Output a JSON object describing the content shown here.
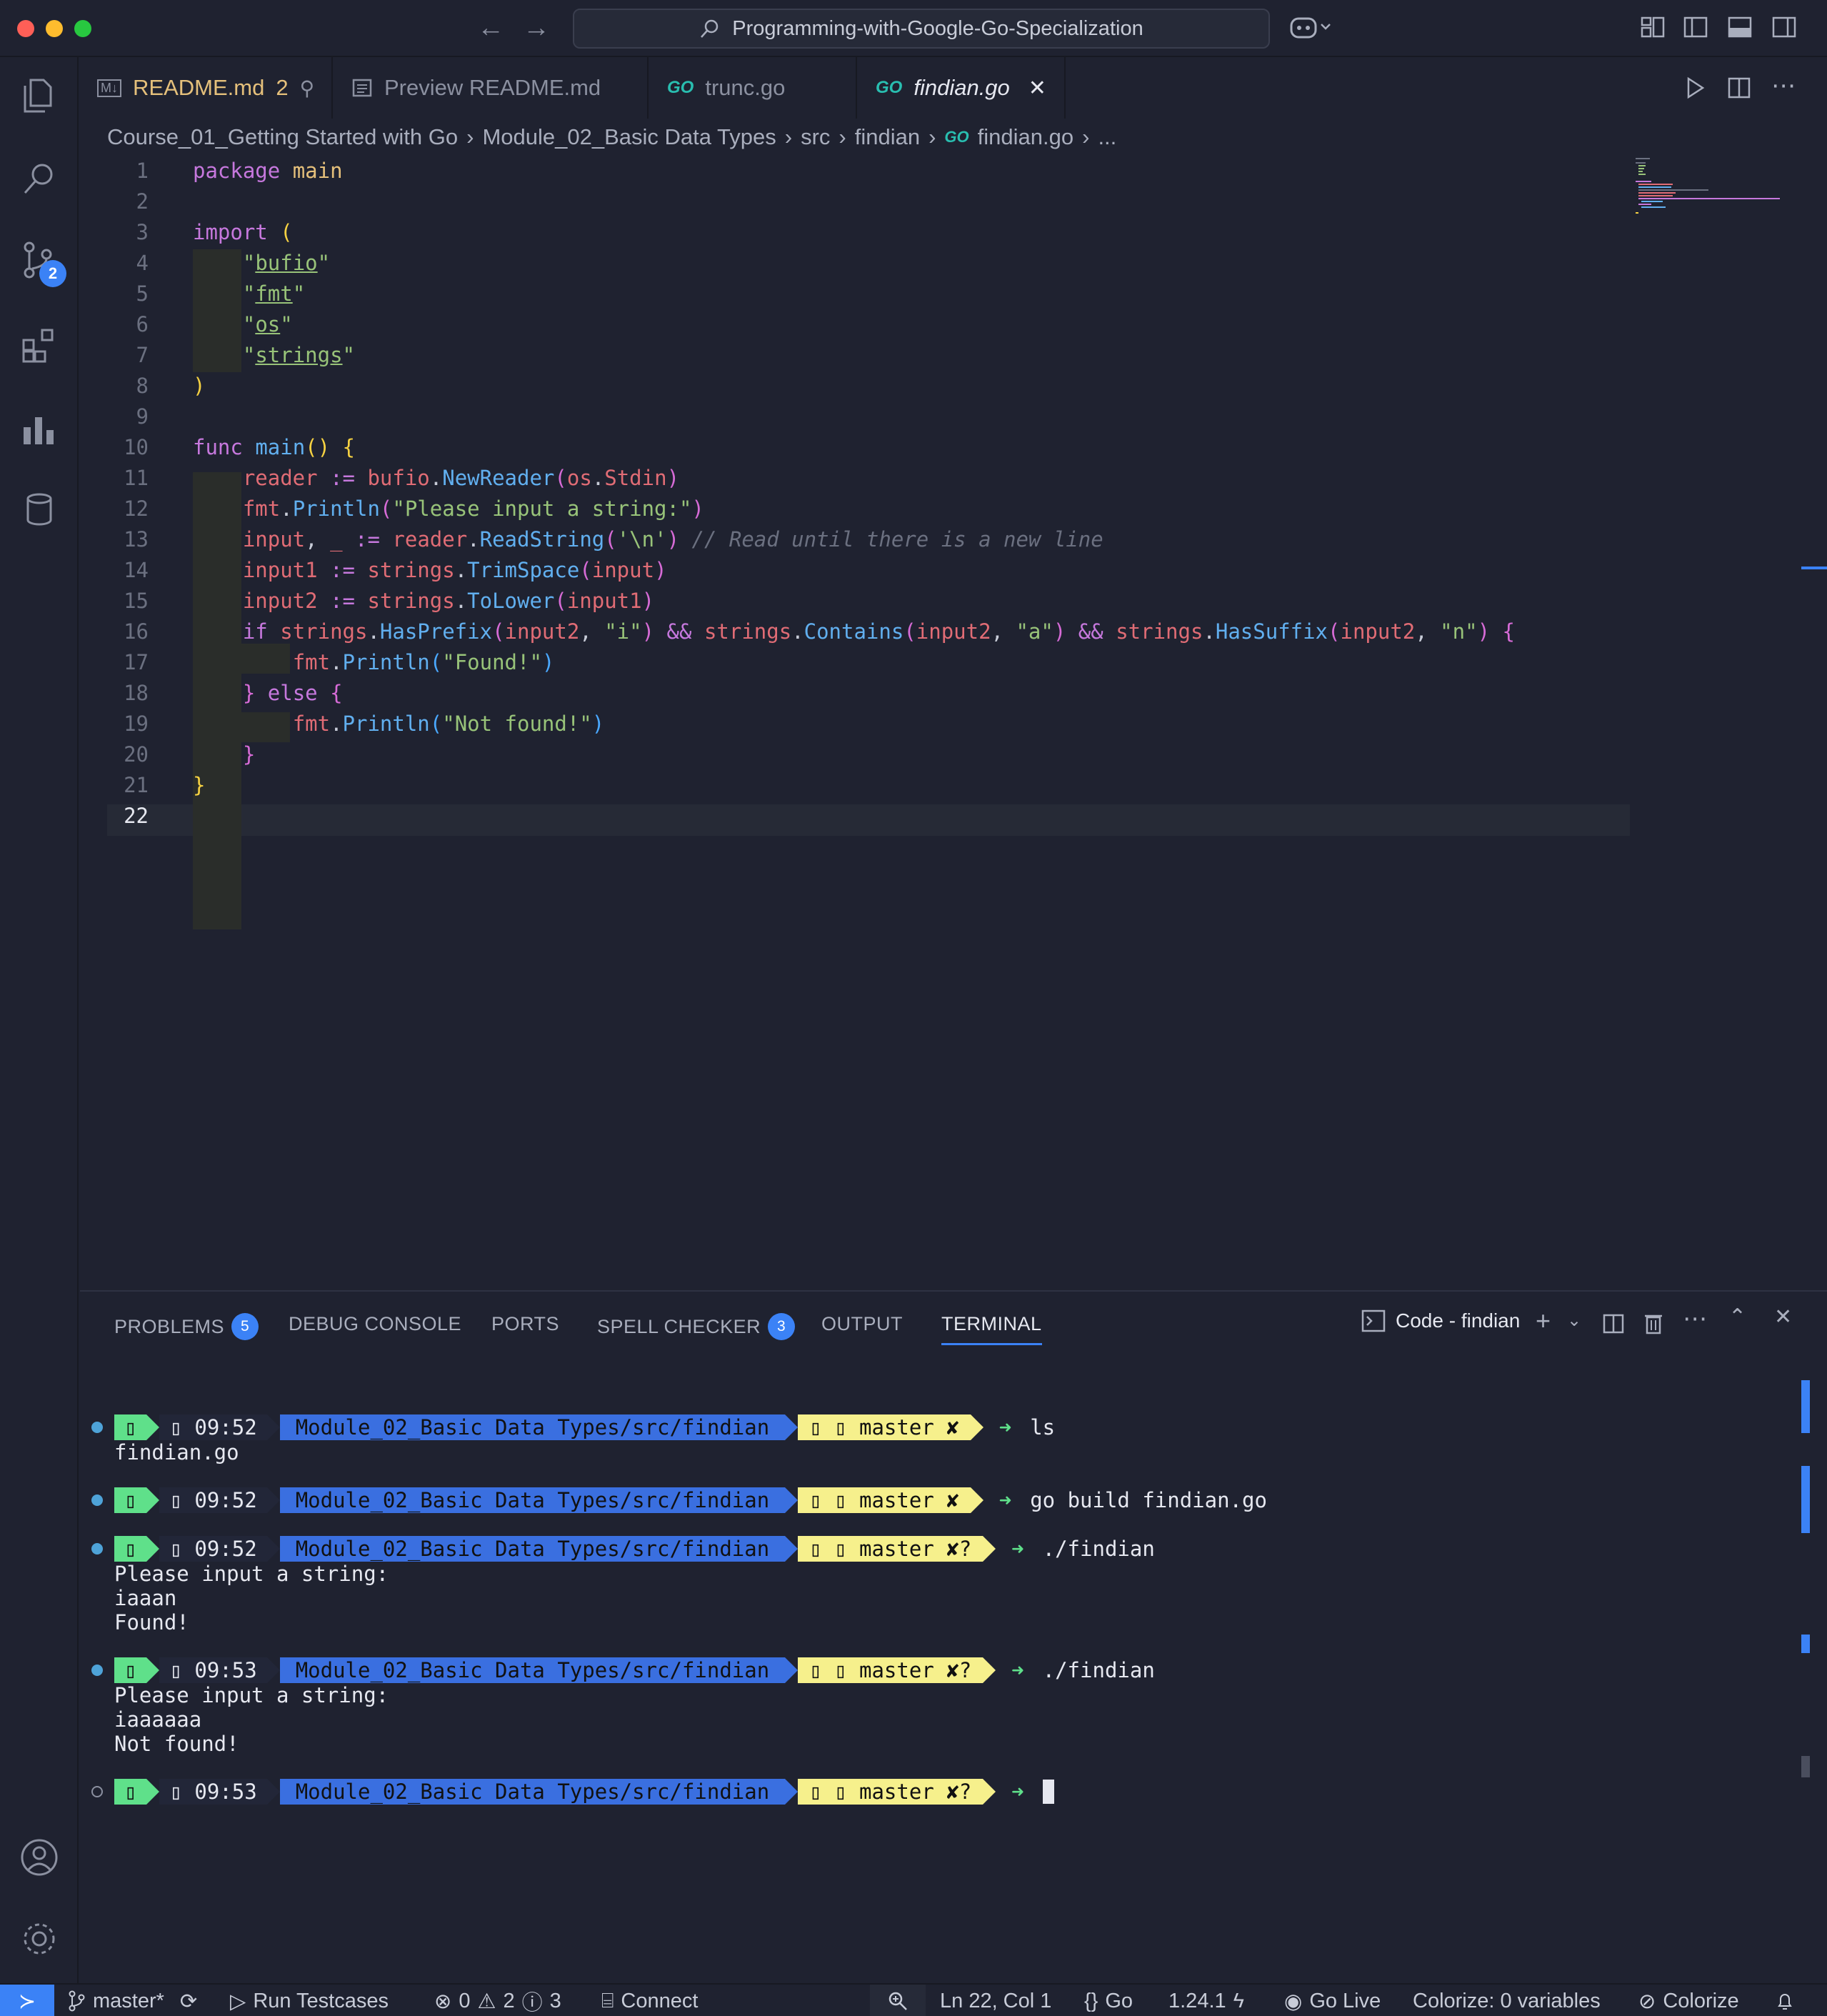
{
  "window": {
    "search_text": "Programming-with-Google-Go-Specialization"
  },
  "activity": {
    "scm_badge": "2"
  },
  "tabs": [
    {
      "icon": "M↓",
      "label": "README.md",
      "extra": "2"
    },
    {
      "icon": "preview",
      "label": "Preview README.md"
    },
    {
      "icon": "GO",
      "label": "trunc.go"
    },
    {
      "icon": "GO",
      "label": "findian.go"
    }
  ],
  "breadcrumb": [
    "Course_01_Getting Started with Go",
    "Module_02_Basic Data Types",
    "src",
    "findian",
    "findian.go",
    "..."
  ],
  "editor": {
    "line_numbers": [
      "1",
      "2",
      "3",
      "4",
      "5",
      "6",
      "7",
      "8",
      "9",
      "10",
      "11",
      "12",
      "13",
      "14",
      "15",
      "16",
      "17",
      "18",
      "19",
      "20",
      "21",
      "22"
    ],
    "current_line": "22"
  },
  "panel": {
    "tabs": [
      {
        "label": "PROBLEMS",
        "count": "5"
      },
      {
        "label": "DEBUG CONSOLE"
      },
      {
        "label": "PORTS"
      },
      {
        "label": "SPELL CHECKER",
        "count": "3"
      },
      {
        "label": "OUTPUT"
      },
      {
        "label": "TERMINAL"
      }
    ],
    "terminal_name": "Code - findian"
  },
  "terminal": {
    "prompt_time_1": "09:52",
    "prompt_time_2": "09:53",
    "prompt_path": "Module_02_Basic Data Types/src/findian",
    "git_branch": "master",
    "git_status_a": "✘",
    "git_status_b": "✘?",
    "cmd1": "ls",
    "out1": "findian.go",
    "cmd2": "go build findian.go",
    "cmd3": "./findian",
    "out3a": "Please input a string:",
    "out3b": "iaaan",
    "out3c": "Found!",
    "cmd4": "./findian",
    "out4a": "Please input a string:",
    "out4b": "iaaaaaa",
    "out4c": "Not found!"
  },
  "statusbar": {
    "branch": "master*",
    "run": "Run Testcases",
    "errors": "0",
    "warnings": "2",
    "infos": "3",
    "connect": "Connect",
    "position": "Ln 22, Col 1",
    "language": "Go",
    "go_version": "1.24.1",
    "golive": "Go Live",
    "colorize_vars": "Colorize: 0 variables",
    "colorize": "Colorize"
  },
  "colors": {
    "accent": "#3b82f6",
    "prompt_green": "#5fe08a",
    "prompt_blue": "#3a6fe0",
    "prompt_yellow": "#f6f08c"
  }
}
